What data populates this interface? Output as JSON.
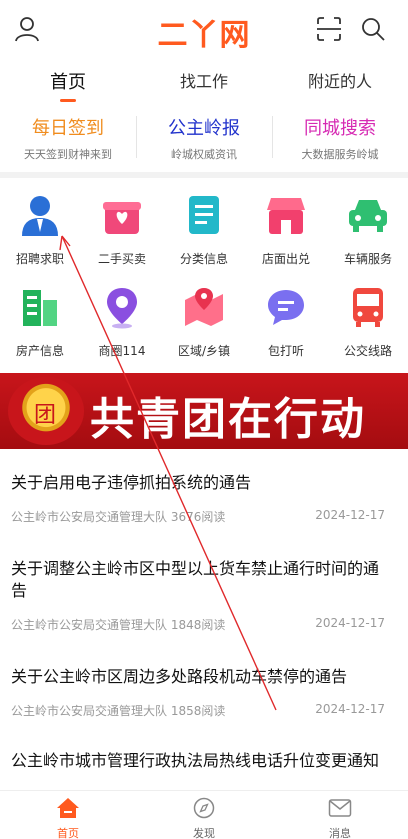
{
  "header": {
    "logo": "二丫网",
    "icons": {
      "user": "user-icon",
      "scan": "scan-icon",
      "search": "search-icon"
    }
  },
  "tabs": [
    {
      "label": "首页",
      "active": true
    },
    {
      "label": "找工作",
      "active": false
    },
    {
      "label": "附近的人",
      "active": false
    }
  ],
  "features": [
    {
      "title": "每日签到",
      "subtitle": "天天签到财神来到",
      "color": "#f08c1e"
    },
    {
      "title": "公主岭报",
      "subtitle": "岭城权威资讯",
      "color": "#2233cc"
    },
    {
      "title": "同城搜索",
      "subtitle": "大数据服务岭城",
      "color": "#d62ab3"
    }
  ],
  "grid": [
    {
      "label": "招聘求职",
      "icon": "person-icon"
    },
    {
      "label": "二手买卖",
      "icon": "gift-icon"
    },
    {
      "label": "分类信息",
      "icon": "document-icon"
    },
    {
      "label": "店面出兑",
      "icon": "shop-icon"
    },
    {
      "label": "车辆服务",
      "icon": "car-icon"
    },
    {
      "label": "房产信息",
      "icon": "building-icon"
    },
    {
      "label": "商圈114",
      "icon": "location-pin-icon"
    },
    {
      "label": "区域/乡镇",
      "icon": "map-icon"
    },
    {
      "label": "包打听",
      "icon": "chat-bubble-icon"
    },
    {
      "label": "公交线路",
      "icon": "bus-icon"
    }
  ],
  "banner": {
    "text": "共青团在行动",
    "badge_text": "团"
  },
  "news": [
    {
      "title": "关于启用电子违停抓拍系统的通告",
      "source": "公主岭市公安局交通管理大队",
      "reads": "3676阅读",
      "date": "2024-12-17"
    },
    {
      "title": "关于调整公主岭市区中型以上货车禁止通行时间的通告",
      "source": "公主岭市公安局交通管理大队",
      "reads": "1848阅读",
      "date": "2024-12-17"
    },
    {
      "title": "关于公主岭市区周边多处路段机动车禁停的通告",
      "source": "公主岭市公安局交通管理大队",
      "reads": "1858阅读",
      "date": "2024-12-17"
    },
    {
      "title": "公主岭市城市管理行政执法局热线电话升位变更通知",
      "source": "",
      "reads": "",
      "date": ""
    }
  ],
  "bottom_nav": [
    {
      "label": "首页",
      "icon": "home-icon",
      "active": true
    },
    {
      "label": "发现",
      "icon": "compass-icon",
      "active": false
    },
    {
      "label": "消息",
      "icon": "mail-icon",
      "active": false
    }
  ],
  "colors": {
    "accent": "#ff5a1f",
    "banner_red": "#c8151b"
  }
}
